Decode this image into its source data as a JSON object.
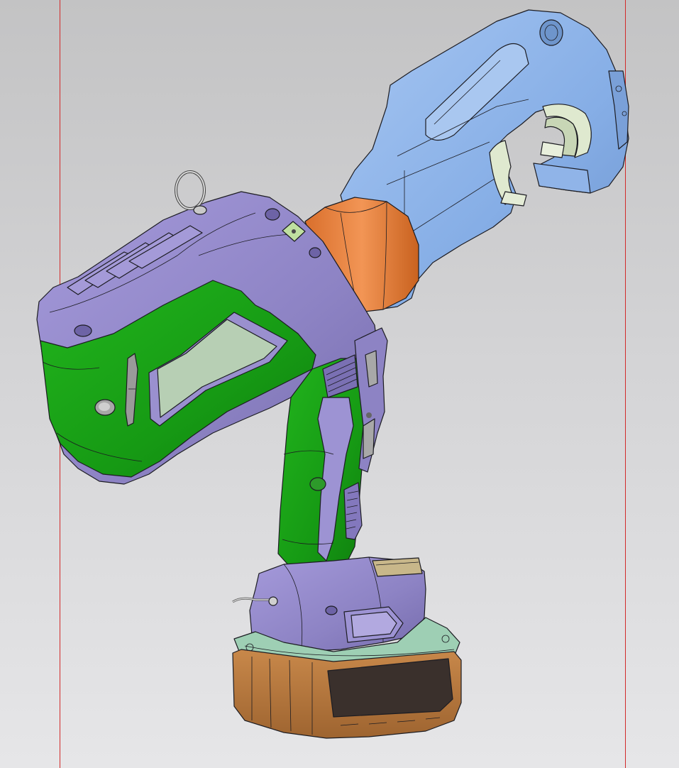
{
  "scene": {
    "background_top": "#c3c3c4",
    "background_bottom": "#e6e6e8",
    "boundary_line_color": "#d22a2a"
  },
  "model": {
    "parts": [
      {
        "name": "crimp-head",
        "color": "#86aee6"
      },
      {
        "name": "cylinder-sleeve",
        "color": "#ef8c48"
      },
      {
        "name": "motor-housing",
        "color": "#8d83c4"
      },
      {
        "name": "side-panel",
        "color": "#169a14"
      },
      {
        "name": "display-window",
        "color": "#b7cfb4"
      },
      {
        "name": "handle-grip",
        "color": "#169a14"
      },
      {
        "name": "battery-mount",
        "color": "#8d83c4"
      },
      {
        "name": "battery-top-plate",
        "color": "#9ecfb4"
      },
      {
        "name": "battery-pack",
        "color": "#b8783a"
      },
      {
        "name": "battery-label",
        "color": "#3a302c"
      }
    ]
  }
}
